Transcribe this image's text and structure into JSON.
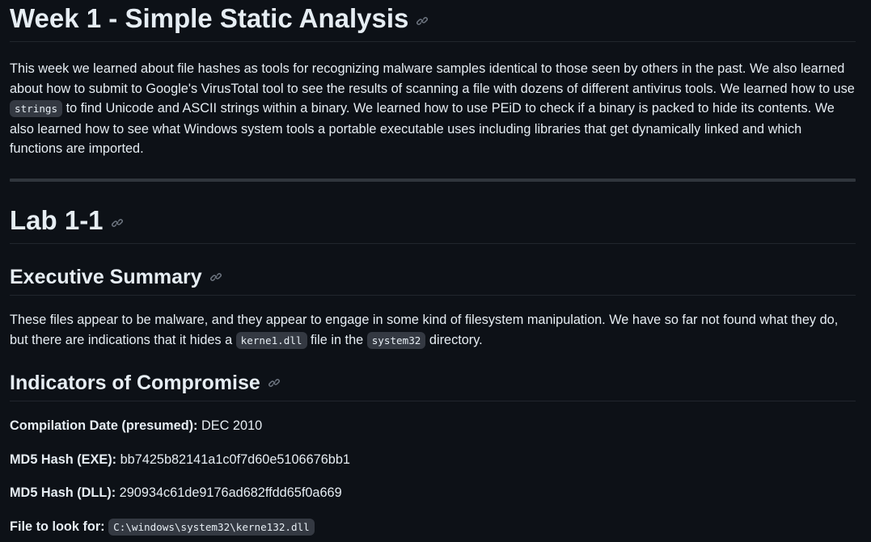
{
  "week_heading": "Week 1 - Simple Static Analysis",
  "intro": {
    "part1": "This week we learned about file hashes as tools for recognizing malware samples identical to those seen by others in the past. We also learned about how to submit to Google's VirusTotal tool to see the results of scanning a file with dozens of different antivirus tools. We learned how to use ",
    "code": "strings",
    "part2": " to find Unicode and ASCII strings within a binary. We learned how to use PEiD to check if a binary is packed to hide its contents. We also learned how to see what Windows system tools a portable executable uses including libraries that get dynamically linked and which functions are imported."
  },
  "lab_heading": "Lab 1-1",
  "executive_summary": {
    "heading": "Executive Summary",
    "part1": "These files appear to be malware, and they appear to engage in some kind of filesystem manipulation. We have so far not found what they do, but there are indications that it hides a ",
    "code1": "kerne1.dll",
    "part2": " file in the ",
    "code2": "system32",
    "part3": " directory."
  },
  "indicators": {
    "heading": "Indicators of Compromise",
    "items": [
      {
        "label": "Compilation Date (presumed):",
        "value": " DEC 2010"
      },
      {
        "label": "MD5 Hash (EXE):",
        "value": " bb7425b82141a1c0f7d60e5106676bb1"
      },
      {
        "label": "MD5 Hash (DLL):",
        "value": " 290934c61de9176ad682ffdd65f0a669"
      },
      {
        "label": "File to look for:",
        "code": "C:\\windows\\system32\\kerne132.dll"
      }
    ]
  },
  "icons": {
    "anchor": "link-icon"
  },
  "colors": {
    "background": "#0d1117",
    "text": "#e6edf3",
    "muted": "#6e7681",
    "border": "#21262d",
    "code_bg": "#343942"
  }
}
